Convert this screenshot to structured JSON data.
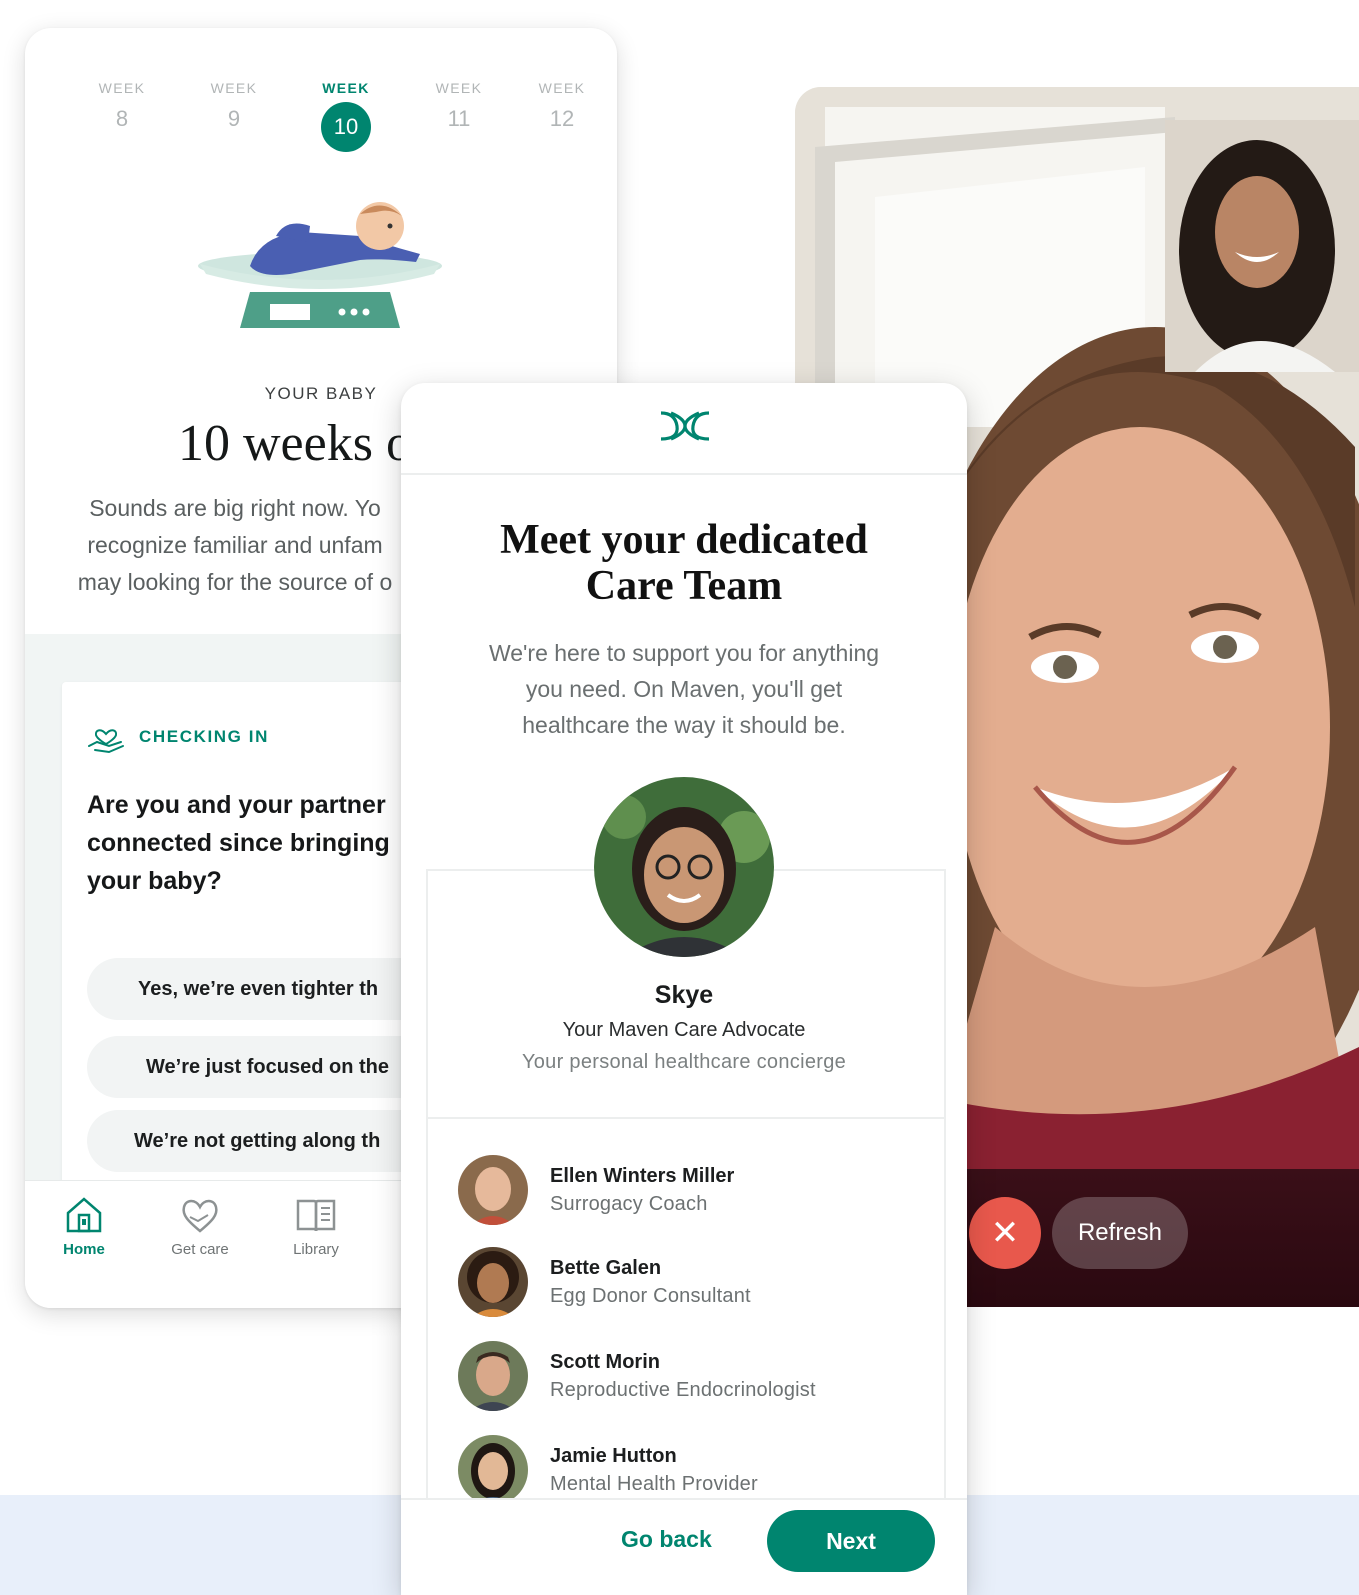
{
  "left_app": {
    "weeks": [
      {
        "label": "WEEK",
        "number": "8"
      },
      {
        "label": "WEEK",
        "number": "9"
      },
      {
        "label": "WEEK",
        "number": "10"
      },
      {
        "label": "WEEK",
        "number": "11"
      },
      {
        "label": "WEEK",
        "number": "12"
      }
    ],
    "active_week": "10",
    "kicker": "YOUR BABY",
    "title": "10 weeks o",
    "description_lines": [
      "Sounds are big right now. Yo",
      "recognize familiar and unfam",
      "may looking for the source of o"
    ],
    "checkin": {
      "label": "CHECKING IN",
      "question_lines": [
        "Are you and your partner",
        "connected since bringing",
        "your baby?"
      ],
      "options": [
        "Yes, we’re even tighter th",
        "We’re just focused on the",
        "We’re not getting along th"
      ]
    },
    "tabs": [
      {
        "label": "Home",
        "icon": "home-icon"
      },
      {
        "label": "Get care",
        "icon": "heart-hand-icon"
      },
      {
        "label": "Library",
        "icon": "book-icon"
      }
    ]
  },
  "care_team": {
    "logo": "maven-logo",
    "title_lines": [
      "Meet your dedicated",
      "Care Team"
    ],
    "subtitle_lines": [
      "We're here to support you for anything",
      "you need. On Maven, you'll get",
      "healthcare the way it should be."
    ],
    "advocate": {
      "name": "Skye",
      "role": "Your Maven Care Advocate",
      "description": "Your personal healthcare concierge"
    },
    "members": [
      {
        "name": "Ellen Winters Miller",
        "role": "Surrogacy Coach"
      },
      {
        "name": "Bette Galen",
        "role": "Egg Donor Consultant"
      },
      {
        "name": "Scott Morin",
        "role": "Reproductive Endocrinologist"
      },
      {
        "name": "Jamie Hutton",
        "role": "Mental Health Provider"
      }
    ],
    "go_back_label": "Go back",
    "next_label": "Next"
  },
  "video_call": {
    "end_icon": "close-icon",
    "refresh_label": "Refresh"
  },
  "colors": {
    "brand_green": "#00856f",
    "end_call_red": "#e8584c",
    "band_blue": "#e8effa"
  }
}
